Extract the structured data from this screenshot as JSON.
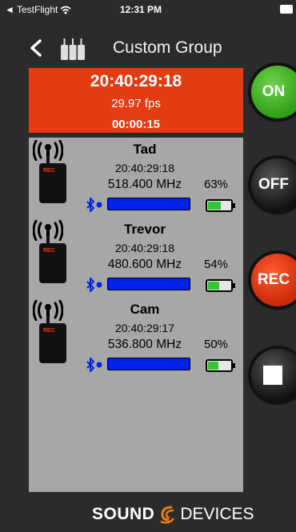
{
  "status_bar": {
    "back_app": "◄ TestFlight",
    "time": "12:31 PM"
  },
  "header": {
    "title": "Custom Group"
  },
  "timecode": {
    "main": "20:40:29:18",
    "fps": "29.97 fps",
    "elapsed": "00:00:15"
  },
  "devices": [
    {
      "name": "Tad",
      "timecode": "20:40:29:18",
      "frequency": "518.400 MHz",
      "battery_label": "63%",
      "battery_fraction": 0.63,
      "tx_label": "REC"
    },
    {
      "name": "Trevor",
      "timecode": "20:40:29:18",
      "frequency": "480.600 MHz",
      "battery_label": "54%",
      "battery_fraction": 0.54,
      "tx_label": "REC"
    },
    {
      "name": "Cam",
      "timecode": "20:40:29:17",
      "frequency": "536.800 MHz",
      "battery_label": "50%",
      "battery_fraction": 0.5,
      "tx_label": "REC"
    }
  ],
  "controls": {
    "on_label": "ON",
    "off_label": "OFF",
    "rec_label": "REC",
    "stop_icon": "stop-icon"
  },
  "footer": {
    "logo_sound": "SOUND",
    "logo_devices": "DEVICES"
  },
  "colors": {
    "timecode_bg": "#e43b12",
    "list_bg": "#a7a7a7",
    "on_green": "#2f9e18",
    "rec_red": "#e43b12",
    "signal_blue": "#0022ee",
    "battery_green": "#32c832"
  }
}
